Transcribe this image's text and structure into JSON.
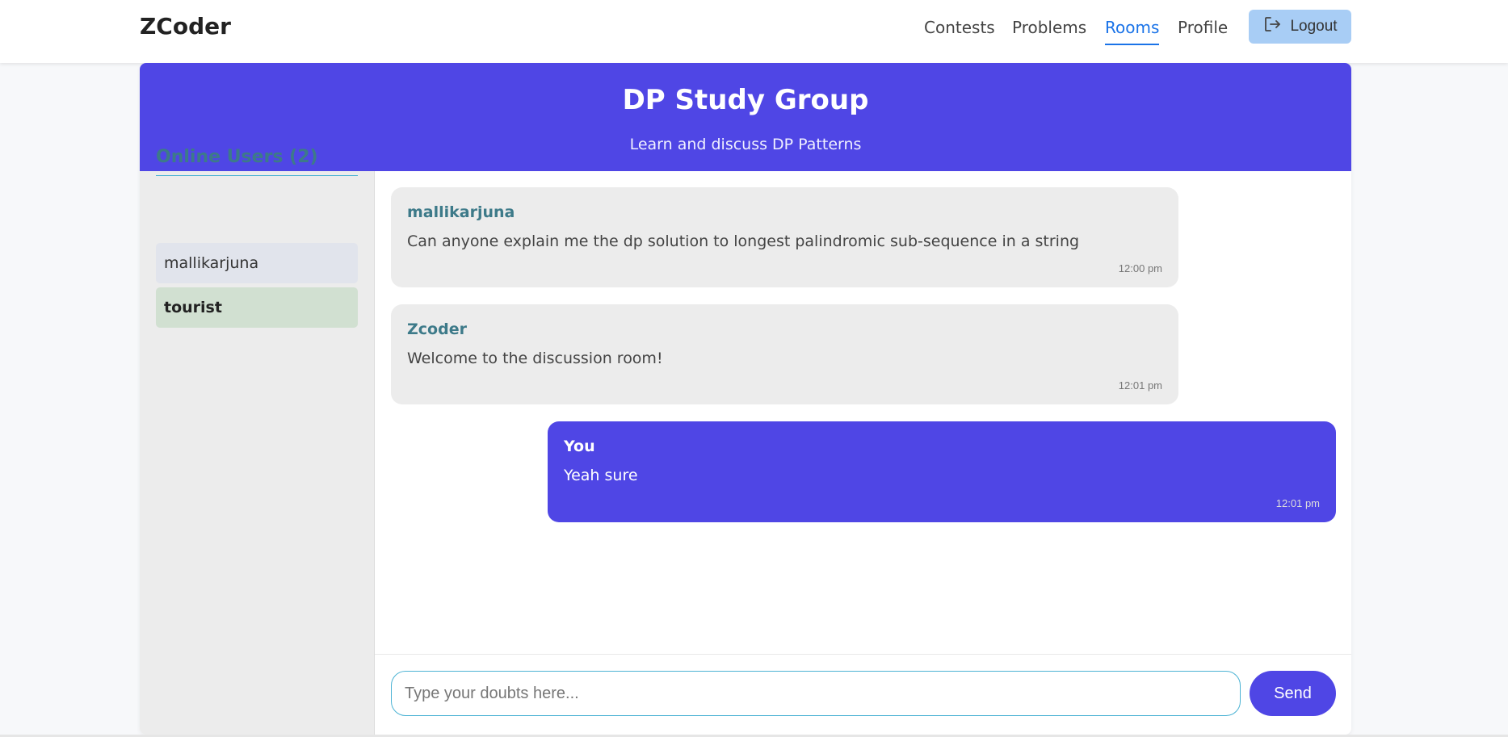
{
  "nav": {
    "brand": "ZCoder",
    "links": [
      "Contests",
      "Problems",
      "Rooms",
      "Profile"
    ],
    "active": "Rooms",
    "logout_label": "Logout"
  },
  "room": {
    "title": "DP Study Group",
    "subtitle": "Learn and discuss DP Patterns"
  },
  "sidebar": {
    "title": "Online Users (2)",
    "users": [
      "mallikarjuna",
      "tourist"
    ]
  },
  "messages": [
    {
      "author": "mallikarjuna",
      "text": "Can anyone explain me the dp solution to longest palindromic sub-sequence in a string",
      "time": "12:00 pm",
      "self": false
    },
    {
      "author": "Zcoder",
      "text": "Welcome to the discussion room!",
      "time": "12:01 pm",
      "self": false
    },
    {
      "author": "You",
      "text": "Yeah sure",
      "time": "12:01 pm",
      "self": true
    }
  ],
  "composer": {
    "placeholder": "Type your doubts here...",
    "value": "",
    "send_label": "Send"
  },
  "colors": {
    "primary": "#4f46e5",
    "active_link": "#1a73e8",
    "logout_bg": "#a8cdf5",
    "accent_teal": "#3d7a89"
  },
  "icons": {
    "logout": "logout-icon"
  }
}
